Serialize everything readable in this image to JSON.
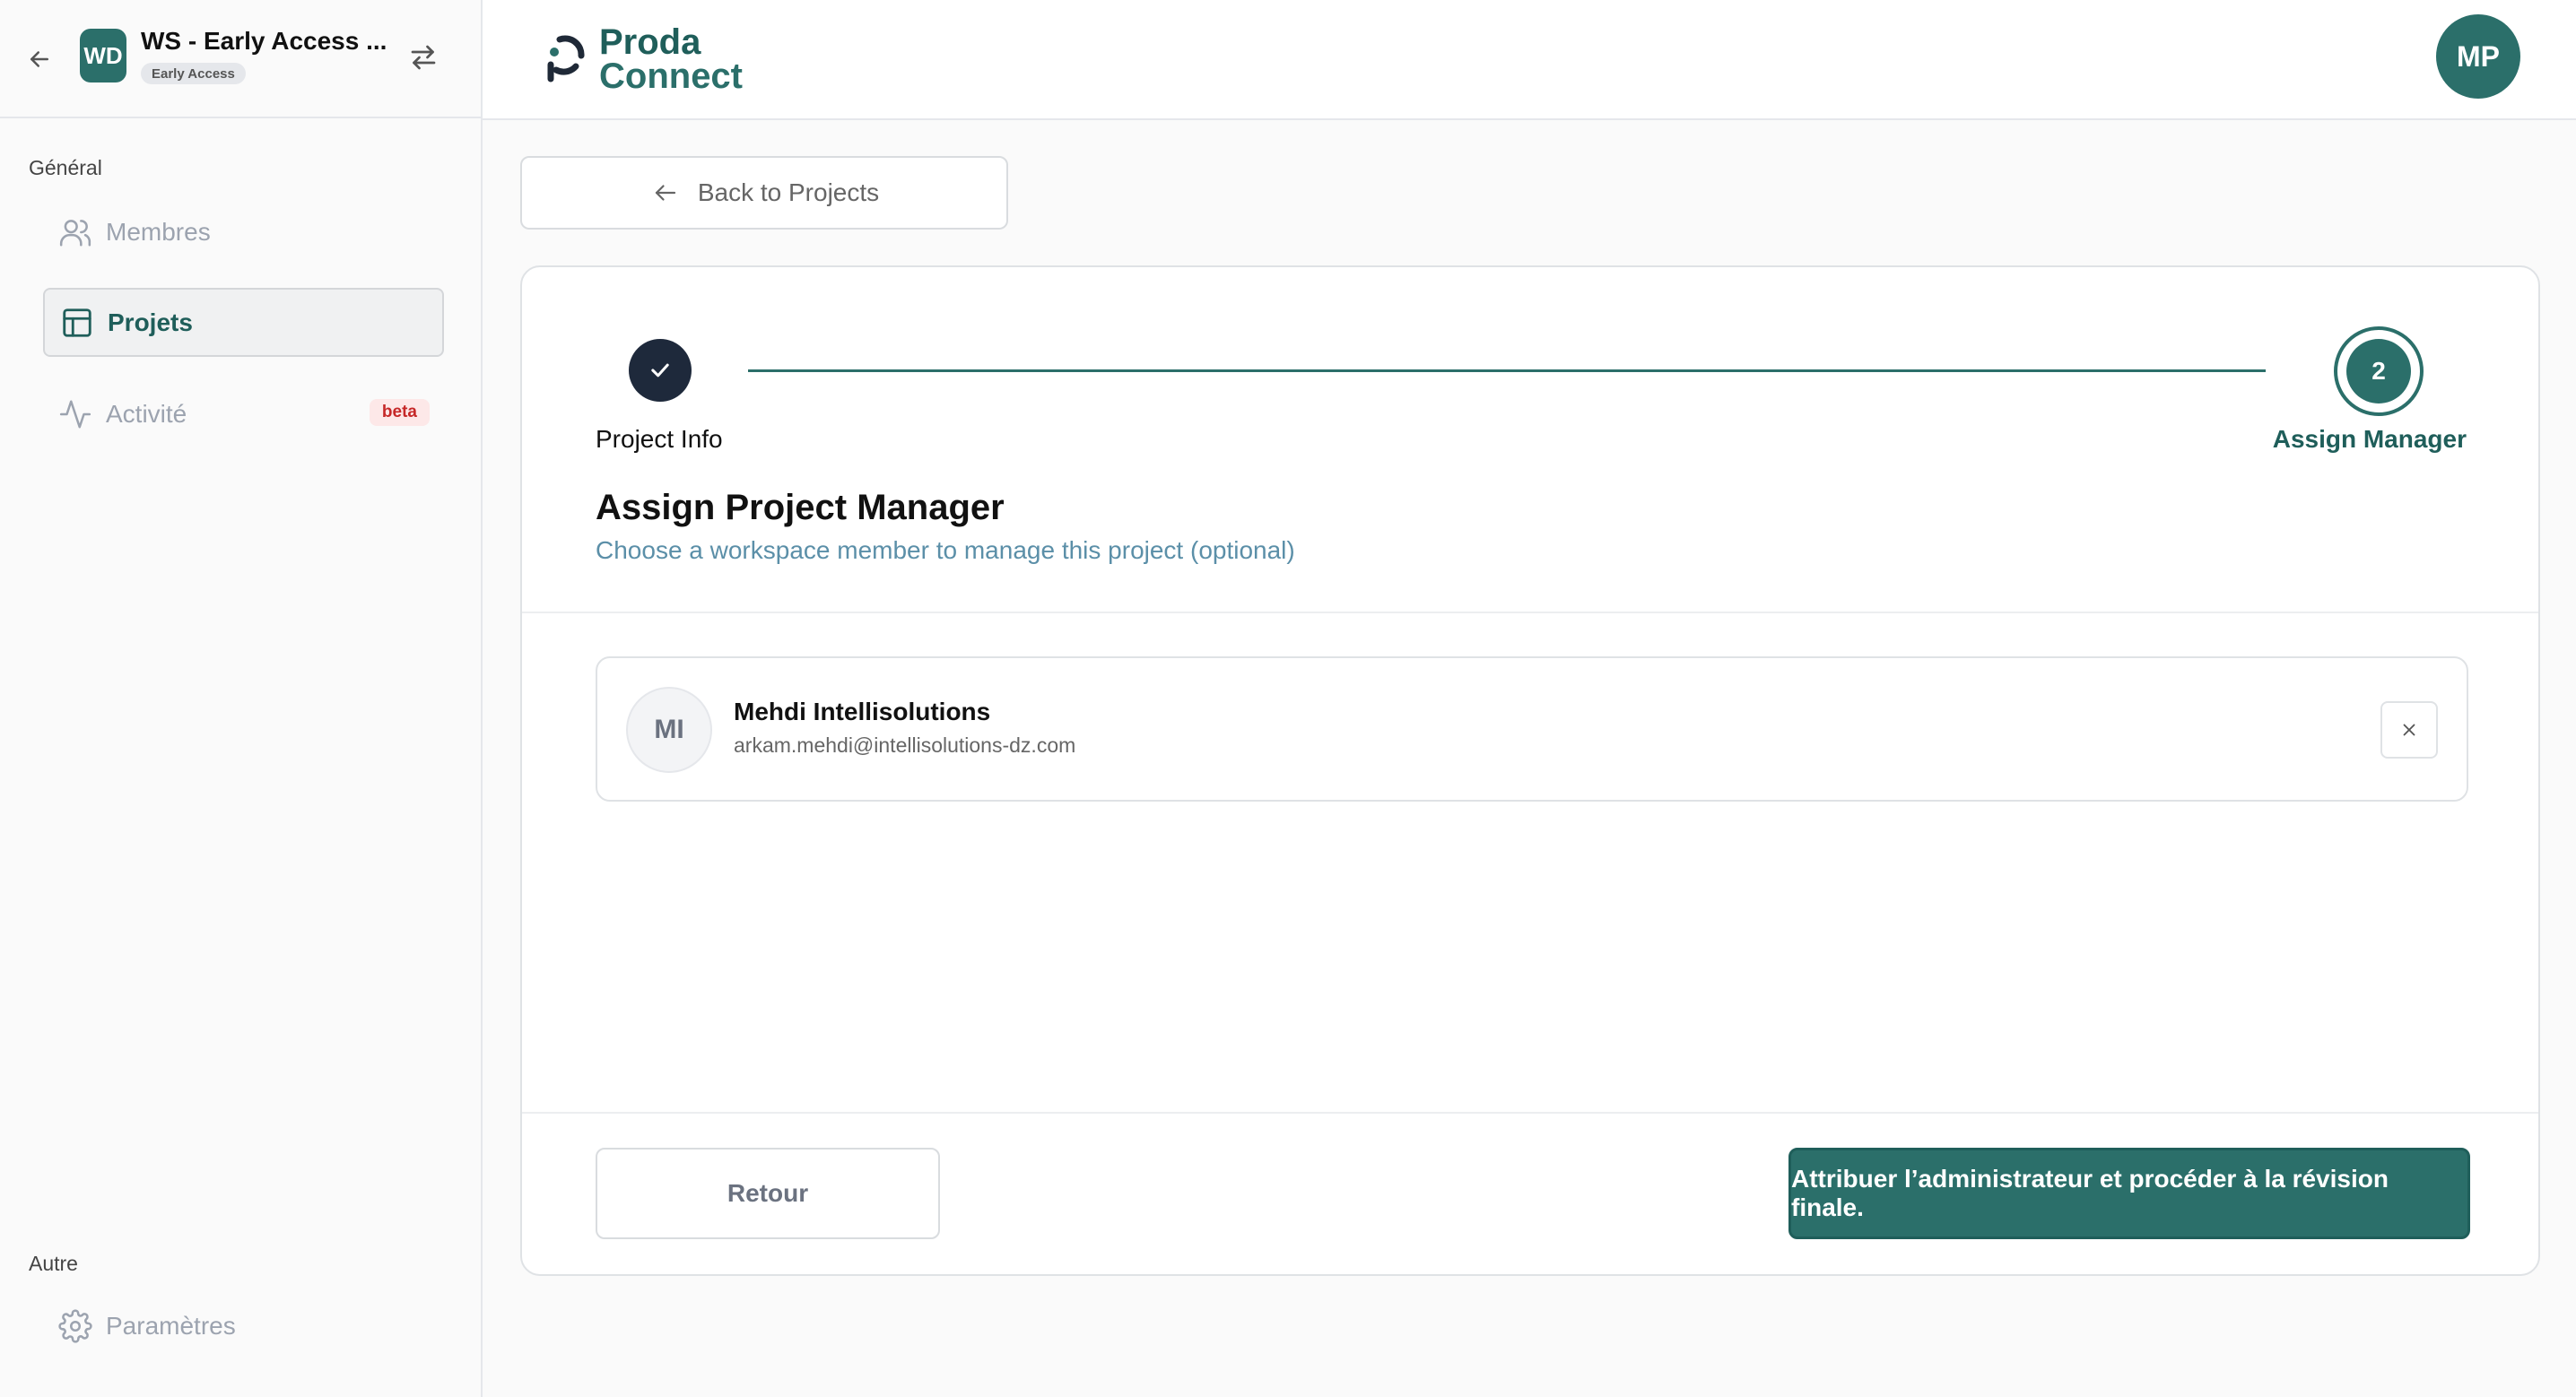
{
  "workspace": {
    "initials": "WD",
    "name": "WS - Early Access ...",
    "badge": "Early Access"
  },
  "sidebar": {
    "sections": [
      {
        "label": "Général"
      },
      {
        "label": "Autre"
      }
    ],
    "items": [
      {
        "label": "Membres",
        "icon": "users-icon",
        "active": false
      },
      {
        "label": "Projets",
        "icon": "table-layout-icon",
        "active": true
      },
      {
        "label": "Activité",
        "icon": "activity-icon",
        "active": false,
        "badge": "beta"
      },
      {
        "label": "Paramètres",
        "icon": "gear-icon",
        "active": false
      }
    ]
  },
  "brand": {
    "line1": "Proda",
    "line2": "Connect",
    "accent": "#2b6f6a"
  },
  "user": {
    "initials": "MP"
  },
  "back_button": {
    "label": "Back to Projects"
  },
  "stepper": {
    "steps": [
      {
        "label": "Project Info",
        "state": "complete"
      },
      {
        "label": "Assign Manager",
        "number": "2",
        "state": "current"
      }
    ]
  },
  "main": {
    "title": "Assign Project Manager",
    "subtitle": "Choose a workspace member to manage this project (optional)"
  },
  "selected_member": {
    "initials": "MI",
    "name": "Mehdi Intellisolutions",
    "email": "arkam.mehdi@intellisolutions-dz.com"
  },
  "footer": {
    "back_label": "Retour",
    "submit_label": "Attribuer l’administrateur et procéder à la révision finale."
  }
}
